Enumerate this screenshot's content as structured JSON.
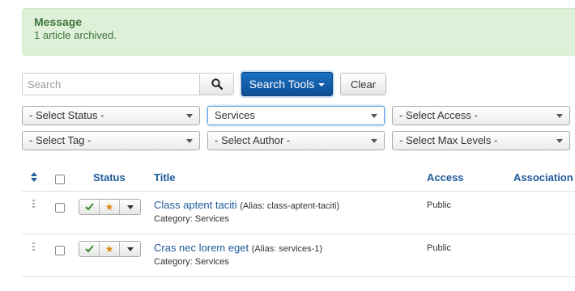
{
  "alert": {
    "heading": "Message",
    "message": "1 article archived."
  },
  "search": {
    "placeholder": "Search",
    "tools_label": "Search Tools",
    "clear_label": "Clear"
  },
  "filters": {
    "status": "- Select Status -",
    "category": "Services",
    "access": "- Select Access -",
    "tag": "- Select Tag -",
    "author": "- Select Author -",
    "max_levels": "- Select Max Levels -"
  },
  "table": {
    "headers": {
      "status": "Status",
      "title": "Title",
      "access": "Access",
      "association": "Association"
    },
    "rows": [
      {
        "title": "Class aptent taciti",
        "alias": "(Alias: class-aptent-taciti)",
        "category": "Category: Services",
        "access": "Public"
      },
      {
        "title": "Cras nec lorem eget",
        "alias": "(Alias: services-1)",
        "category": "Category: Services",
        "access": "Public"
      }
    ]
  },
  "colors": {
    "published": "#3a8a2e",
    "featured": "#d98a10",
    "link": "#1f5a9a",
    "primary": "#0d4e93"
  },
  "icons": {
    "search": "search-icon",
    "publish": "check-icon",
    "featured": "star-icon",
    "more": "caret-down-icon",
    "order": "sort-icon",
    "drag": "drag-handle-icon"
  }
}
